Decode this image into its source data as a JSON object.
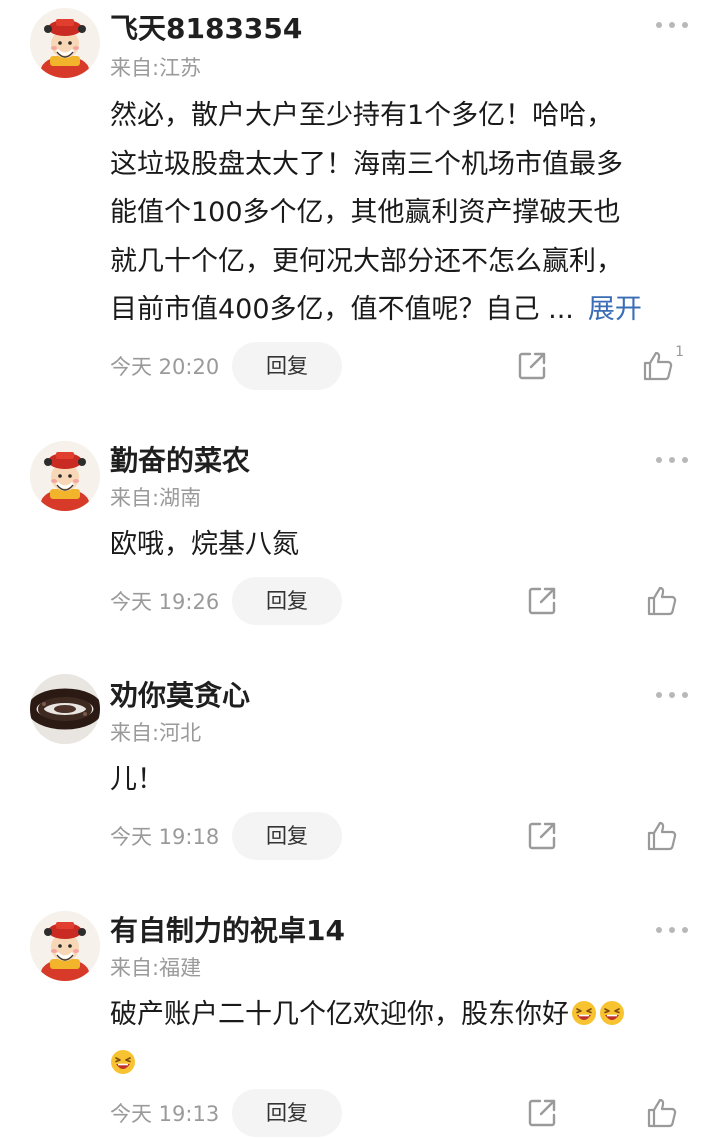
{
  "comments": [
    {
      "username": "飞天8183354",
      "location": "来自:江苏",
      "lines": [
        "然必，散户大户至少持有1个多亿！哈哈，",
        "这垃圾股盘太大了！海南三个机场市值最多",
        "能值个100多个亿，其他赢利资产撑破天也",
        "就几十个亿，更何况大部分还不怎么赢利，",
        "目前市值400多亿，值不值呢？自己 ..."
      ],
      "expand_label": "展开",
      "timestamp": "今天 20:20",
      "reply_label": "回复",
      "like_count": "1",
      "avatar": "cartoon-god-of-wealth"
    },
    {
      "username": "勤奋的菜农",
      "location": "来自:湖南",
      "lines": [
        "欧哦，烷基八氮"
      ],
      "timestamp": "今天 19:26",
      "reply_label": "回复",
      "avatar": "cartoon-god-of-wealth"
    },
    {
      "username": "劝你莫贪心",
      "location": "来自:河北",
      "lines": [
        "儿！"
      ],
      "timestamp": "今天 19:18",
      "reply_label": "回复",
      "avatar": "dark-bead-bracelet"
    },
    {
      "username": "有自制力的祝卓14",
      "location": "来自:福建",
      "lines": [
        "破产账户二十几个亿欢迎你，股东你好"
      ],
      "emoji": "laughing-emoji",
      "timestamp": "今天 19:13",
      "reply_label": "回复",
      "avatar": "cartoon-god-of-wealth"
    }
  ],
  "colors": {
    "accent_link": "#3a6db5",
    "meta_gray": "#9a9a9a",
    "reply_bg": "#f4f4f4"
  },
  "icons": {
    "more": "more-dots-icon",
    "share": "share-icon",
    "like": "thumbs-up-icon"
  }
}
